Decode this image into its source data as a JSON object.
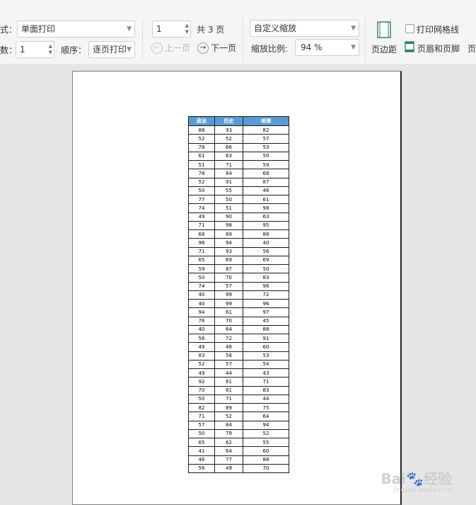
{
  "toolbar": {
    "mode_label": "式：",
    "mode_value": "单面打印",
    "copies_label": "数：",
    "copies_value": "1",
    "order_label": "顺序：",
    "order_value": "逐页打印",
    "page_input": "1",
    "total_pages": "共 3 页",
    "prev_page": "上一页",
    "next_page": "下一页",
    "zoom_mode": "自定义缩放",
    "zoom_label": "缩放比例:",
    "zoom_value": "94 %",
    "margin_label": "页边距",
    "gridlines_label": "打印网格线",
    "header_footer_label": "页眉和页脚",
    "more_label": "页"
  },
  "table": {
    "headers": [
      "政治",
      "历史",
      "地理"
    ],
    "rows": [
      [
        "88",
        "93",
        "82"
      ],
      [
        "52",
        "52",
        "57"
      ],
      [
        "78",
        "66",
        "53"
      ],
      [
        "61",
        "63",
        "50"
      ],
      [
        "51",
        "71",
        "59"
      ],
      [
        "78",
        "84",
        "68"
      ],
      [
        "52",
        "91",
        "87"
      ],
      [
        "50",
        "55",
        "46"
      ],
      [
        "77",
        "50",
        "61"
      ],
      [
        "74",
        "51",
        "98"
      ],
      [
        "49",
        "90",
        "63"
      ],
      [
        "71",
        "98",
        "95"
      ],
      [
        "68",
        "89",
        "88"
      ],
      [
        "96",
        "94",
        "40"
      ],
      [
        "71",
        "93",
        "56"
      ],
      [
        "65",
        "69",
        "69"
      ],
      [
        "59",
        "87",
        "50"
      ],
      [
        "50",
        "70",
        "83"
      ],
      [
        "74",
        "57",
        "96"
      ],
      [
        "40",
        "99",
        "72"
      ],
      [
        "40",
        "99",
        "96"
      ],
      [
        "94",
        "61",
        "97"
      ],
      [
        "76",
        "70",
        "45"
      ],
      [
        "40",
        "64",
        "88"
      ],
      [
        "56",
        "72",
        "91"
      ],
      [
        "49",
        "48",
        "60"
      ],
      [
        "83",
        "58",
        "53"
      ],
      [
        "52",
        "57",
        "54"
      ],
      [
        "49",
        "44",
        "43"
      ],
      [
        "92",
        "81",
        "71"
      ],
      [
        "70",
        "81",
        "83"
      ],
      [
        "50",
        "71",
        "44"
      ],
      [
        "82",
        "89",
        "75"
      ],
      [
        "71",
        "52",
        "64"
      ],
      [
        "57",
        "84",
        "94"
      ],
      [
        "50",
        "79",
        "52"
      ],
      [
        "65",
        "62",
        "55"
      ],
      [
        "41",
        "64",
        "60"
      ],
      [
        "46",
        "77",
        "88"
      ],
      [
        "56",
        "49",
        "70"
      ]
    ]
  },
  "watermark": {
    "brand": "Bai🐾经验",
    "url": "jingyan.baidu.com"
  },
  "colors": {
    "header_bg": "#5b9bd5",
    "toolbar_bg": "#f5f5f5",
    "canvas_bg": "#e6e6e6"
  }
}
